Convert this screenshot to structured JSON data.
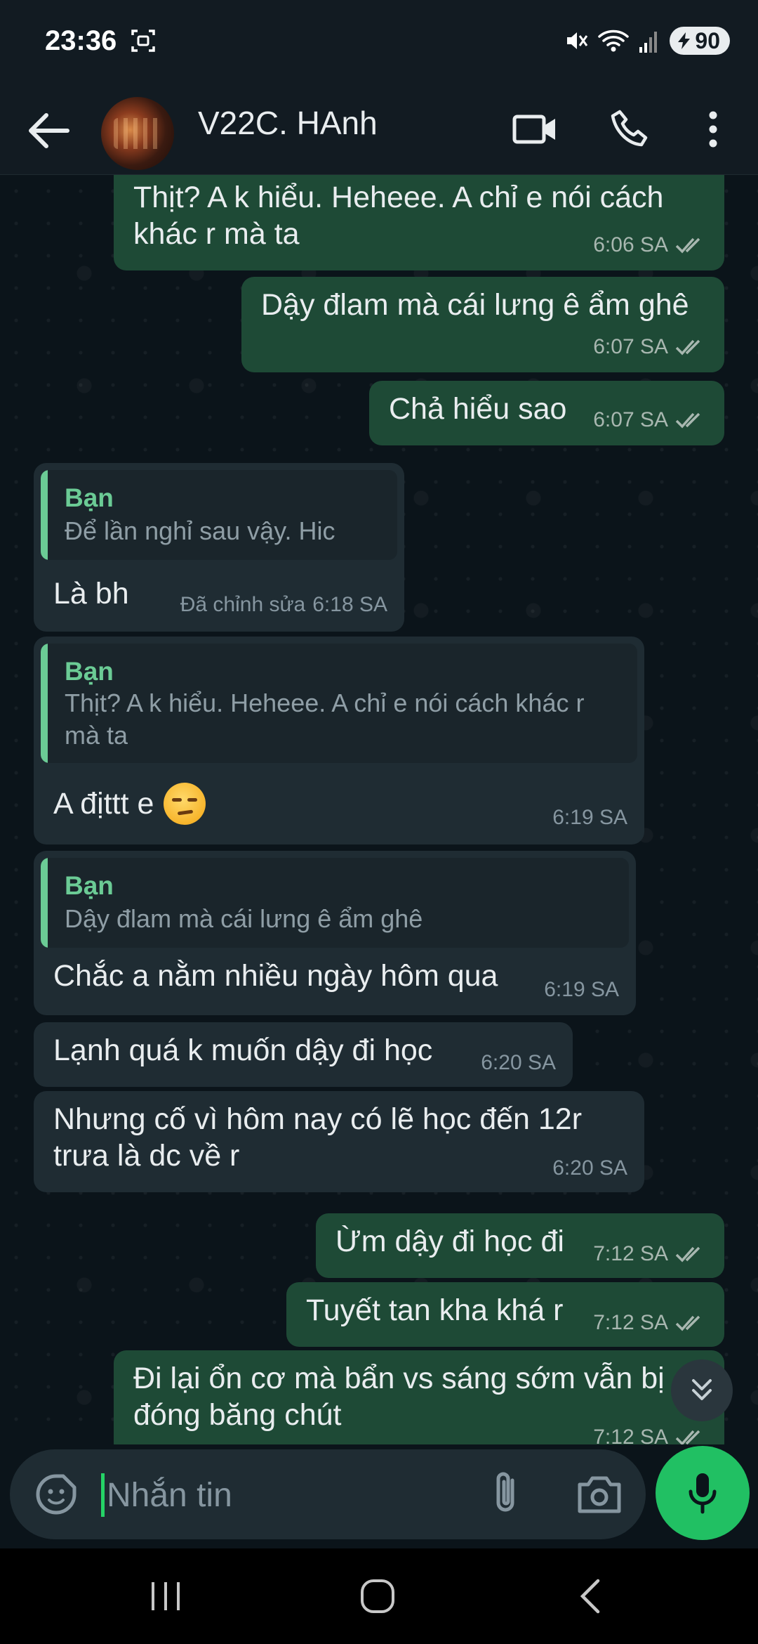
{
  "status_bar": {
    "time": "23:36",
    "battery": "90"
  },
  "header": {
    "contact_name": "V22C. HAnh"
  },
  "messages": [
    {
      "dir": "out",
      "text": "Thịt? A k hiểu. Heheee. A chỉ e nói cách khác r mà ta",
      "time": "6:06 SA"
    },
    {
      "dir": "out",
      "text": "Dậy đlam mà cái lưng ê ẩm ghê",
      "time": "6:07 SA"
    },
    {
      "dir": "out",
      "text": "Chả hiểu sao",
      "time": "6:07 SA"
    },
    {
      "dir": "in",
      "quote_author": "Bạn",
      "quote_text": "Để lần nghỉ sau vậy. Hic",
      "text": "Là bh",
      "edited": "Đã chỉnh sửa",
      "time": "6:18 SA"
    },
    {
      "dir": "in",
      "quote_author": "Bạn",
      "quote_text": "Thịt? A k hiểu. Heheee. A chỉ e nói cách khác r mà ta",
      "text": "A địttt e",
      "emoji": "unamused-face",
      "time": "6:19 SA"
    },
    {
      "dir": "in",
      "quote_author": "Bạn",
      "quote_text": "Dậy đlam mà cái lưng ê ẩm ghê",
      "text": "Chắc a nằm nhiều ngày hôm qua",
      "time": "6:19 SA"
    },
    {
      "dir": "in",
      "text": "Lạnh quá k muốn dậy đi học",
      "time": "6:20 SA"
    },
    {
      "dir": "in",
      "text": "Nhưng cố vì hôm nay có lẽ học đến 12r trưa là dc về r",
      "time": "6:20 SA"
    },
    {
      "dir": "out",
      "text": "Ừm dậy đi học đi",
      "time": "7:12 SA"
    },
    {
      "dir": "out",
      "text": "Tuyết tan kha khá r",
      "time": "7:12 SA"
    },
    {
      "dir": "out",
      "text": "Đi lại ổn cơ mà bẩn vs sáng sớm vẫn bị đóng băng chút",
      "time": "7:12 SA"
    }
  ],
  "composer": {
    "placeholder": "Nhắn tin"
  },
  "colors": {
    "outgoing_bubble": "#1e4a36",
    "incoming_bubble": "#1f2c33",
    "accent": "#21c063",
    "quote_author": "#6bcb95"
  }
}
